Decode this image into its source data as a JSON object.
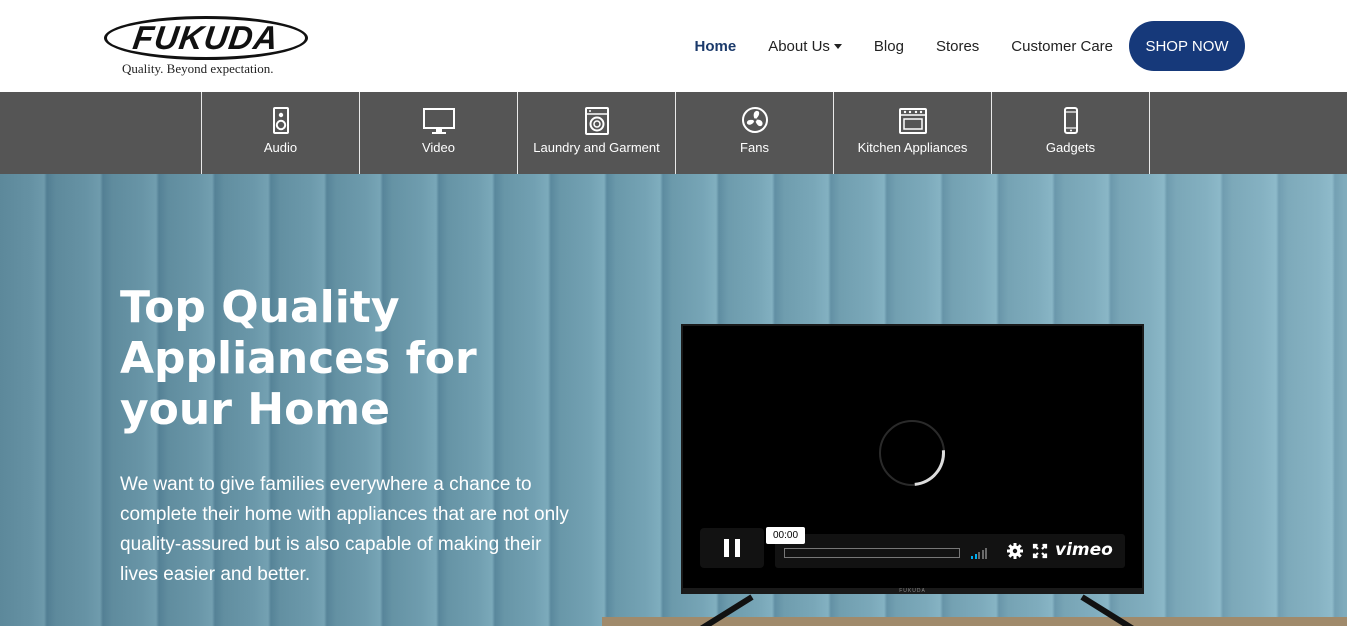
{
  "brand": {
    "name": "FUKUDA",
    "tagline": "Quality. Beyond expectation."
  },
  "nav": {
    "items": [
      {
        "label": "Home",
        "active": true
      },
      {
        "label": "About Us",
        "dropdown": true
      },
      {
        "label": "Blog"
      },
      {
        "label": "Stores"
      },
      {
        "label": "Customer Care"
      }
    ],
    "cta": "SHOP NOW"
  },
  "categories": [
    {
      "label": "Audio",
      "icon": "speaker-icon"
    },
    {
      "label": "Video",
      "icon": "monitor-icon"
    },
    {
      "label": "Laundry and Garment",
      "icon": "washing-machine-icon"
    },
    {
      "label": "Fans",
      "icon": "fan-icon"
    },
    {
      "label": "Kitchen Appliances",
      "icon": "oven-icon"
    },
    {
      "label": "Gadgets",
      "icon": "phone-icon"
    }
  ],
  "hero": {
    "title": "Top Quality Appliances for your Home",
    "description": "We want to give families everywhere a chance to complete their home with appliances that are not only quality-assured but is also capable of making their lives easier and better."
  },
  "video": {
    "time": "00:00",
    "tv_brand": "FUKUDA",
    "provider": "vimeo",
    "progress": 0
  },
  "colors": {
    "primary": "#16397a",
    "category_bar": "#555555",
    "nav_active": "#1b3a6b"
  }
}
